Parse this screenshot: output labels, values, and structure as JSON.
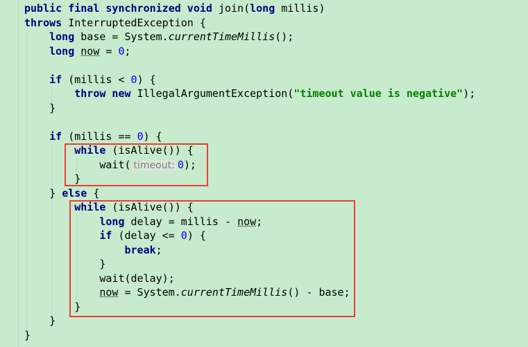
{
  "colors": {
    "background": "#c7ebcc",
    "keyword": "#000080",
    "number": "#0000ff",
    "string": "#008000",
    "highlight_box": "#f03a3a"
  },
  "lines": [
    [
      {
        "t": "public final synchronized void",
        "c": "kw"
      },
      {
        "t": " join(",
        "c": ""
      },
      {
        "t": "long",
        "c": "kw"
      },
      {
        "t": " millis)",
        "c": ""
      }
    ],
    [
      {
        "t": "throws",
        "c": "kw"
      },
      {
        "t": " InterruptedException {",
        "c": ""
      }
    ],
    [
      {
        "t": "    ",
        "c": ""
      },
      {
        "t": "long",
        "c": "kw"
      },
      {
        "t": " base = System.",
        "c": ""
      },
      {
        "t": "currentTimeMillis",
        "c": "it"
      },
      {
        "t": "();",
        "c": ""
      }
    ],
    [
      {
        "t": "    ",
        "c": ""
      },
      {
        "t": "long",
        "c": "kw"
      },
      {
        "t": " ",
        "c": ""
      },
      {
        "t": "now",
        "c": "ul"
      },
      {
        "t": " = ",
        "c": ""
      },
      {
        "t": "0",
        "c": "num"
      },
      {
        "t": ";",
        "c": ""
      }
    ],
    [],
    [
      {
        "t": "    ",
        "c": ""
      },
      {
        "t": "if",
        "c": "kw"
      },
      {
        "t": " (millis < ",
        "c": ""
      },
      {
        "t": "0",
        "c": "num"
      },
      {
        "t": ") {",
        "c": ""
      }
    ],
    [
      {
        "t": "        ",
        "c": ""
      },
      {
        "t": "throw new",
        "c": "kw"
      },
      {
        "t": " IllegalArgumentException(",
        "c": ""
      },
      {
        "t": "\"timeout value is negative\"",
        "c": "str"
      },
      {
        "t": ");",
        "c": ""
      }
    ],
    [
      {
        "t": "    }",
        "c": ""
      }
    ],
    [],
    [
      {
        "t": "    ",
        "c": ""
      },
      {
        "t": "if",
        "c": "kw"
      },
      {
        "t": " (millis == ",
        "c": ""
      },
      {
        "t": "0",
        "c": "num"
      },
      {
        "t": ") {",
        "c": ""
      }
    ],
    [
      {
        "t": "        ",
        "c": ""
      },
      {
        "t": "while",
        "c": "kw"
      },
      {
        "t": " (isAlive()) {",
        "c": ""
      }
    ],
    [
      {
        "t": "            wait(",
        "c": ""
      },
      {
        "t": "timeout:",
        "c": "hint"
      },
      {
        "t": "0",
        "c": "num"
      },
      {
        "t": ");",
        "c": ""
      }
    ],
    [
      {
        "t": "        }",
        "c": ""
      }
    ],
    [
      {
        "t": "    } ",
        "c": ""
      },
      {
        "t": "else",
        "c": "kw"
      },
      {
        "t": " {",
        "c": ""
      }
    ],
    [
      {
        "t": "        ",
        "c": ""
      },
      {
        "t": "while",
        "c": "kw"
      },
      {
        "t": " (isAlive()) {",
        "c": ""
      }
    ],
    [
      {
        "t": "            ",
        "c": ""
      },
      {
        "t": "long",
        "c": "kw"
      },
      {
        "t": " delay = millis - ",
        "c": ""
      },
      {
        "t": "now",
        "c": "ul"
      },
      {
        "t": ";",
        "c": ""
      }
    ],
    [
      {
        "t": "            ",
        "c": ""
      },
      {
        "t": "if",
        "c": "kw"
      },
      {
        "t": " (delay <= ",
        "c": ""
      },
      {
        "t": "0",
        "c": "num"
      },
      {
        "t": ") {",
        "c": ""
      }
    ],
    [
      {
        "t": "                ",
        "c": ""
      },
      {
        "t": "break",
        "c": "kw"
      },
      {
        "t": ";",
        "c": ""
      }
    ],
    [
      {
        "t": "            }",
        "c": ""
      }
    ],
    [
      {
        "t": "            wait(delay);",
        "c": ""
      }
    ],
    [
      {
        "t": "            ",
        "c": ""
      },
      {
        "t": "now",
        "c": "ul"
      },
      {
        "t": " = System.",
        "c": ""
      },
      {
        "t": "currentTimeMillis",
        "c": "it"
      },
      {
        "t": "() - base;",
        "c": ""
      }
    ],
    [
      {
        "t": "        }",
        "c": ""
      }
    ],
    [
      {
        "t": "    }",
        "c": ""
      }
    ],
    [
      {
        "t": "}",
        "c": ""
      }
    ]
  ]
}
